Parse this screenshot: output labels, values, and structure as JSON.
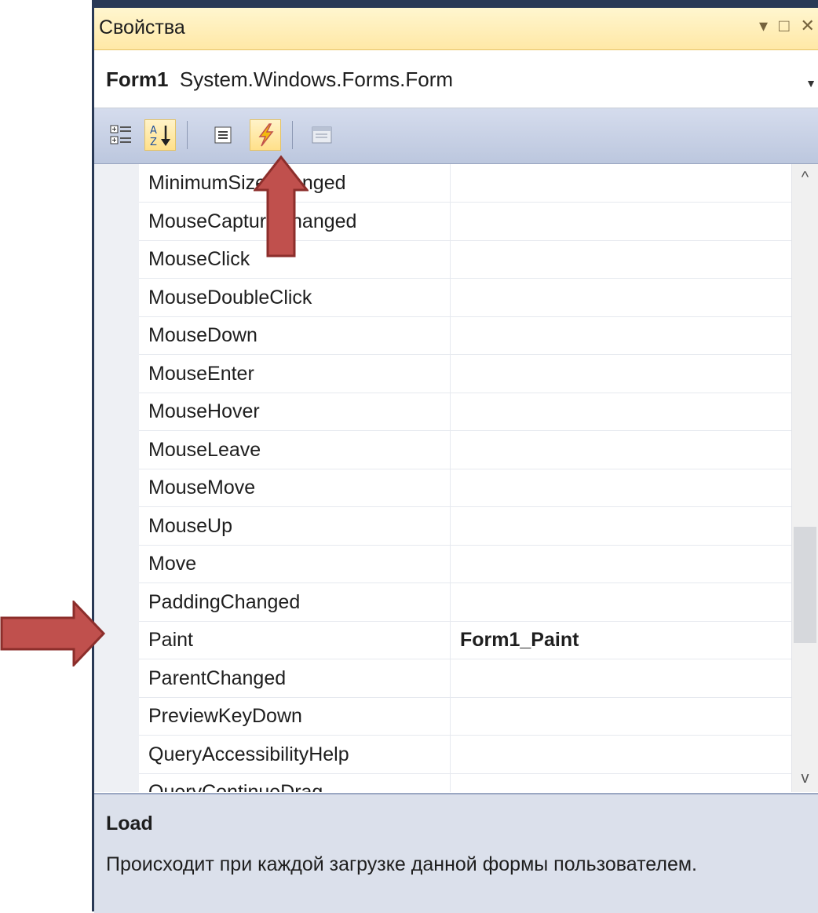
{
  "window": {
    "title": "Свойства",
    "controls": "▾ □ ✕"
  },
  "object_selector": {
    "name": "Form1",
    "type": "System.Windows.Forms.Form"
  },
  "toolbar": {
    "buttons": [
      "categorized",
      "alphabetical",
      "properties",
      "events",
      "property-pages"
    ],
    "active": "events"
  },
  "events": [
    {
      "name": "MinimumSizeChanged",
      "handler": ""
    },
    {
      "name": "MouseCaptureChanged",
      "handler": ""
    },
    {
      "name": "MouseClick",
      "handler": ""
    },
    {
      "name": "MouseDoubleClick",
      "handler": ""
    },
    {
      "name": "MouseDown",
      "handler": ""
    },
    {
      "name": "MouseEnter",
      "handler": ""
    },
    {
      "name": "MouseHover",
      "handler": ""
    },
    {
      "name": "MouseLeave",
      "handler": ""
    },
    {
      "name": "MouseMove",
      "handler": ""
    },
    {
      "name": "MouseUp",
      "handler": ""
    },
    {
      "name": "Move",
      "handler": ""
    },
    {
      "name": "PaddingChanged",
      "handler": ""
    },
    {
      "name": "Paint",
      "handler": "Form1_Paint"
    },
    {
      "name": "ParentChanged",
      "handler": ""
    },
    {
      "name": "PreviewKeyDown",
      "handler": ""
    },
    {
      "name": "QueryAccessibilityHelp",
      "handler": ""
    },
    {
      "name": "QueryContinueDrag",
      "handler": ""
    }
  ],
  "description": {
    "title": "Load",
    "text": "Происходит при каждой загрузке данной формы пользователем."
  },
  "colors": {
    "title_bar": "#ffe8a6",
    "arrow": "#c0504d",
    "frame": "#293955"
  }
}
